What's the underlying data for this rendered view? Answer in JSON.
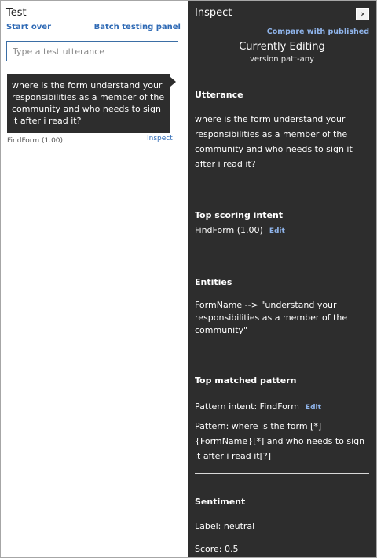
{
  "test_panel": {
    "title": "Test",
    "start_over": "Start over",
    "batch_testing": "Batch testing panel",
    "input_placeholder": "Type a test utterance",
    "utterance_bubble": "where is the form understand your responsibilities as a member of the community and who needs to sign it after i read it?",
    "result_intent": "FindForm (1.00)",
    "inspect_link": "Inspect"
  },
  "inspect_panel": {
    "title": "Inspect",
    "expand_icon": "chevron-right-icon",
    "compare_link": "Compare with published",
    "currently_editing": "Currently Editing",
    "version": "version patt-any",
    "utterance_heading": "Utterance",
    "utterance_text": "where is the form understand your responsibilities as a member of the community and who needs to sign it after i read it?",
    "top_intent_heading": "Top scoring intent",
    "top_intent_value": "FindForm (1.00)",
    "edit_label": "Edit",
    "entities_heading": "Entities",
    "entities_text": "FormName --> \"understand your responsibilities as a member of the community\"",
    "pattern_heading": "Top matched pattern",
    "pattern_intent": "Pattern intent: FindForm",
    "pattern_text": "Pattern: where is the form [*] {FormName}[*] and who needs to sign it after i read it[?]",
    "sentiment_heading": "Sentiment",
    "sentiment_label": "Label: neutral",
    "sentiment_score": "Score: 0.5"
  },
  "colors": {
    "link_blue": "#2f6ab5",
    "panel_dark": "#2d2d2d",
    "accent_light": "#8fb4ea"
  }
}
